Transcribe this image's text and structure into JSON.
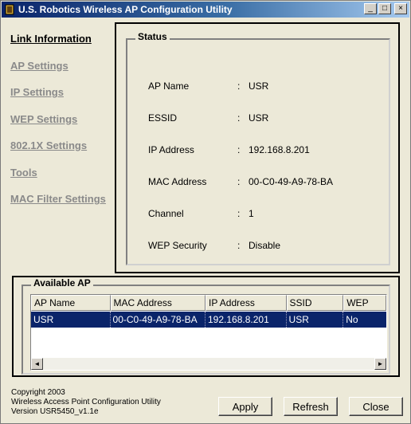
{
  "window": {
    "title": "U.S. Robotics Wireless AP Configuration Utility",
    "controls": {
      "minimize": "_",
      "maximize": "□",
      "close": "×"
    }
  },
  "nav": {
    "items": [
      {
        "label": "Link Information",
        "active": true
      },
      {
        "label": "AP Settings"
      },
      {
        "label": "IP Settings"
      },
      {
        "label": "WEP Settings"
      },
      {
        "label": "802.1X Settings"
      },
      {
        "label": "Tools"
      },
      {
        "label": "MAC Filter Settings"
      }
    ]
  },
  "status": {
    "title": "Status",
    "separator": ":",
    "fields": [
      {
        "label": "AP Name",
        "value": "USR"
      },
      {
        "label": "ESSID",
        "value": "USR"
      },
      {
        "label": "IP Address",
        "value": "192.168.8.201"
      },
      {
        "label": "MAC Address",
        "value": "00-C0-49-A9-78-BA"
      },
      {
        "label": "Channel",
        "value": "1"
      },
      {
        "label": "WEP Security",
        "value": "Disable"
      }
    ]
  },
  "available_ap": {
    "title": "Available AP",
    "columns": [
      "AP Name",
      "MAC Address",
      "IP Address",
      "SSID",
      "WEP"
    ],
    "rows": [
      [
        "USR",
        "00-C0-49-A9-78-BA",
        "192.168.8.201",
        "USR",
        "No"
      ]
    ],
    "scroll_left": "◄",
    "scroll_right": "►"
  },
  "footer": {
    "copyright": "Copyright 2003",
    "product": "Wireless Access Point Configuration Utility",
    "version": "Version USR5450_v1.1e"
  },
  "buttons": {
    "apply": "Apply",
    "refresh": "Refresh",
    "close": "Close"
  },
  "colors": {
    "titlebar": "#0a246a",
    "selection": "#0a246a",
    "nav_inactive": "#8a8a8a"
  }
}
